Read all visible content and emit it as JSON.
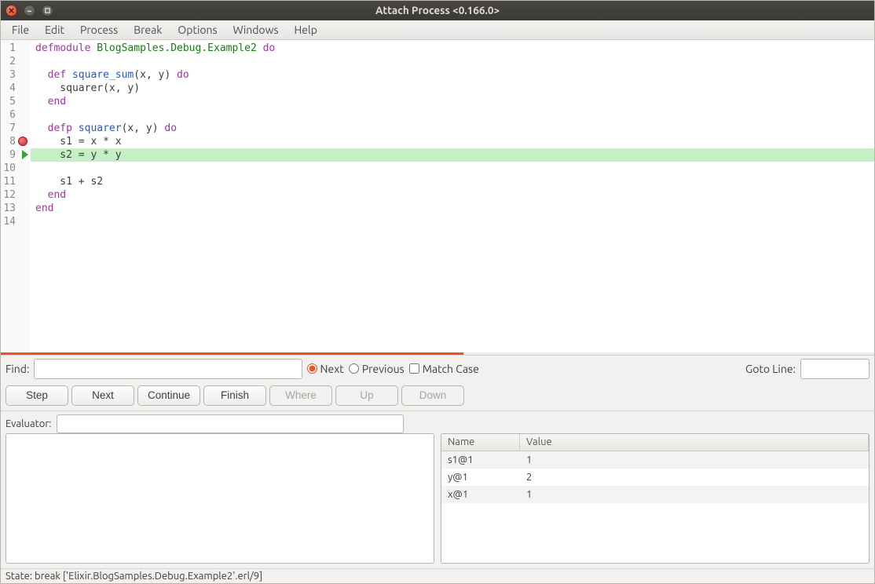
{
  "window": {
    "title": "Attach Process <0.166.0>"
  },
  "menu": {
    "items": [
      "File",
      "Edit",
      "Process",
      "Break",
      "Options",
      "Windows",
      "Help"
    ]
  },
  "code": {
    "breakpoint_line": 8,
    "current_line": 9,
    "lines": [
      {
        "n": 1,
        "segs": [
          {
            "t": "defmodule",
            "c": "kw"
          },
          {
            "t": " "
          },
          {
            "t": "BlogSamples.Debug.Example2",
            "c": "mod"
          },
          {
            "t": " "
          },
          {
            "t": "do",
            "c": "kw"
          }
        ]
      },
      {
        "n": 2,
        "segs": []
      },
      {
        "n": 3,
        "segs": [
          {
            "t": "  "
          },
          {
            "t": "def",
            "c": "kw"
          },
          {
            "t": " "
          },
          {
            "t": "square_sum",
            "c": "fn"
          },
          {
            "t": "(x, y) "
          },
          {
            "t": "do",
            "c": "kw"
          }
        ]
      },
      {
        "n": 4,
        "segs": [
          {
            "t": "    squarer(x, y)"
          }
        ]
      },
      {
        "n": 5,
        "segs": [
          {
            "t": "  "
          },
          {
            "t": "end",
            "c": "kw2"
          }
        ]
      },
      {
        "n": 6,
        "segs": []
      },
      {
        "n": 7,
        "segs": [
          {
            "t": "  "
          },
          {
            "t": "defp",
            "c": "kw"
          },
          {
            "t": " "
          },
          {
            "t": "squarer",
            "c": "fn"
          },
          {
            "t": "(x, y) "
          },
          {
            "t": "do",
            "c": "kw"
          }
        ]
      },
      {
        "n": 8,
        "segs": [
          {
            "t": "    s1 = x * x"
          }
        ]
      },
      {
        "n": 9,
        "segs": [
          {
            "t": "    s2 = y * y"
          }
        ]
      },
      {
        "n": 10,
        "segs": []
      },
      {
        "n": 11,
        "segs": [
          {
            "t": "    s1 + s2"
          }
        ]
      },
      {
        "n": 12,
        "segs": [
          {
            "t": "  "
          },
          {
            "t": "end",
            "c": "kw2"
          }
        ]
      },
      {
        "n": 13,
        "segs": [
          {
            "t": "end",
            "c": "kw2"
          }
        ]
      },
      {
        "n": 14,
        "segs": []
      }
    ]
  },
  "find": {
    "label": "Find:",
    "value": "",
    "next": "Next",
    "previous": "Previous",
    "match_case": "Match Case",
    "direction": "next",
    "match_case_checked": false,
    "goto_label": "Goto Line:",
    "goto_value": ""
  },
  "buttons": {
    "step": "Step",
    "next": "Next",
    "continue": "Continue",
    "finish": "Finish",
    "where": "Where",
    "up": "Up",
    "down": "Down"
  },
  "evaluator": {
    "label": "Evaluator:",
    "value": "",
    "output": ""
  },
  "vars": {
    "headers": {
      "name": "Name",
      "value": "Value"
    },
    "rows": [
      {
        "name": "s1@1",
        "value": "1"
      },
      {
        "name": "y@1",
        "value": "2"
      },
      {
        "name": "x@1",
        "value": "1"
      }
    ]
  },
  "status": {
    "text": "State: break ['Elixir.BlogSamples.Debug.Example2'.erl/9]"
  }
}
